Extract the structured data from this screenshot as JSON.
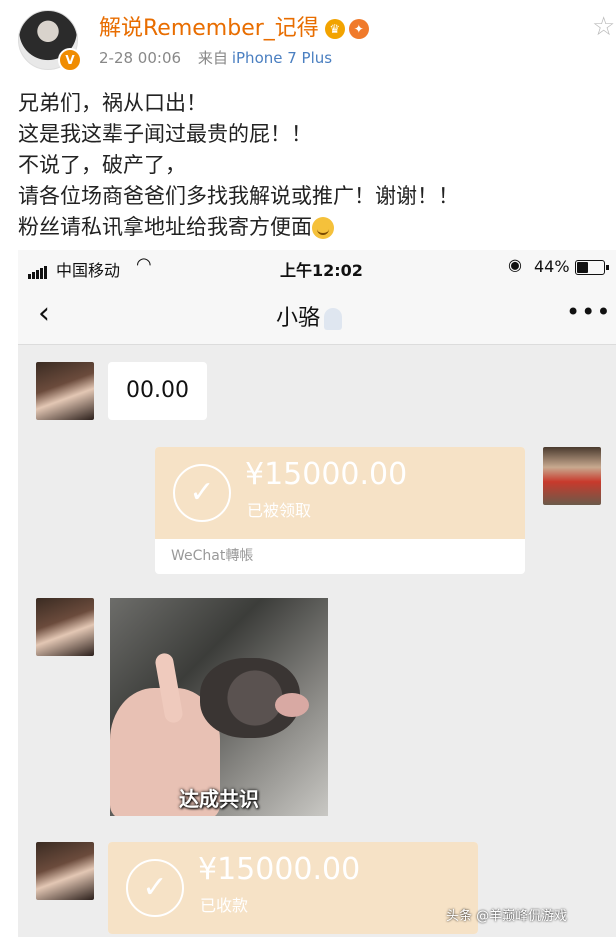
{
  "post": {
    "username": "解说Remember_记得",
    "time": "2-28 00:06",
    "source_prefix": "来自",
    "device": "iPhone 7 Plus",
    "lines": [
      "兄弟们，祸从口出！",
      "这是我这辈子闻过最贵的屁！！",
      "不说了，破产了，",
      "请各位场商爸爸们多找我解说或推广！谢谢！！",
      "粉丝请私讯拿地址给我寄方便面"
    ]
  },
  "phone": {
    "carrier": "中国移动",
    "time": "上午12:02",
    "battery": "44%",
    "chat_title": "小骆",
    "messages": {
      "text1": "00.00",
      "transfer1_amount": "¥15000.00",
      "transfer1_status": "已被领取",
      "transfer1_footer": "WeChat轉帳",
      "sticker_caption": "达成共识",
      "transfer2_amount": "¥15000.00",
      "transfer2_status": "已收款"
    }
  },
  "watermark": "头条 @羊巅峰侃游戏"
}
